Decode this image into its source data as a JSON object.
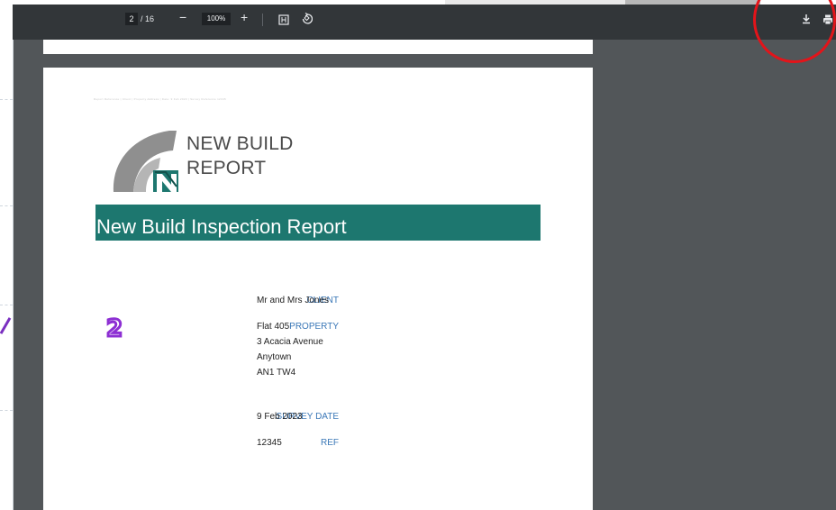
{
  "toolbar": {
    "page_current": "2",
    "page_total": "/ 16",
    "zoom_out": "−",
    "zoom_level": "100%",
    "zoom_in": "+"
  },
  "icons": [
    "fit-page-icon",
    "rotate-icon",
    "download-icon",
    "print-icon"
  ],
  "annotations": {
    "number_badge": "2"
  },
  "document": {
    "header_line": "Report Reference | Client | Property Address | Date: 9 Feb 2023 | Survey Reference 12345",
    "brand_line1": "NEW BUILD",
    "brand_line2": "REPORT",
    "title": "New Build Inspection Report",
    "fields": {
      "client_label": "CLIENT",
      "client_value": "Mr and Mrs Jones",
      "property_label": "PROPERTY",
      "property_lines": [
        "Flat 405",
        "3 Acacia Avenue",
        "Anytown",
        "AN1 TW4"
      ],
      "survey_date_label": "SURVEY DATE",
      "survey_date_value": "9 Feb 2023",
      "ref_label": "REF",
      "ref_value": "12345"
    }
  },
  "colors": {
    "toolbar_bg": "#323639",
    "viewer_bg": "#525659",
    "banner_teal": "#1d776f",
    "label_blue": "#3a77b7",
    "highlight_circle": "#e3141a",
    "badge_purple": "#8d2fd3"
  }
}
